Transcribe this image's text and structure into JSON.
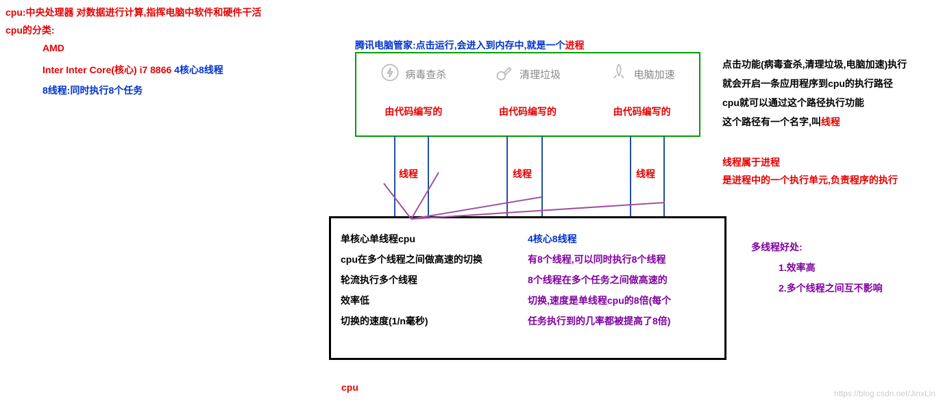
{
  "header": {
    "line1_red": "cpu:中央处理器 对数据进行计算,指挥电脑中软件和硬件干活",
    "line2_red": "cpu的分类:",
    "amd": "AMD",
    "inter_red": "Inter Inter Core(核心) i7 8866",
    "inter_blue": " 4核心8线程",
    "threads8": "8线程:同时执行8个任务"
  },
  "tencent": {
    "title_blue": "腾讯电脑管家:点击运行,会进入到内存中,就是一个",
    "title_red": "进程",
    "btn1": "病毒查杀",
    "btn2": "清理垃圾",
    "btn3": "电脑加速",
    "code1": "由代码编写的",
    "code2": "由代码编写的",
    "code3": "由代码编写的"
  },
  "right": {
    "l1": "点击功能(病毒查杀,清理垃圾,电脑加速)执行",
    "l2": "就会开启一条应用程序到cpu的执行路径",
    "l3_a": "cpu就可以通过这个路径执行功能",
    "l4_a": "这个路径有一个名字,叫",
    "l4_b": "线程",
    "r1": "线程属于进程",
    "r2": "是进程中的一个执行单元,负责程序的执行",
    "m_title": "多线程好处:",
    "m1": "1.效率高",
    "m2": "2.多个线程之间互不影响"
  },
  "threadlabels": {
    "t1": "线程",
    "t2": "线程",
    "t3": "线程"
  },
  "cpubox": {
    "left_title": "单核心单线程cpu",
    "left_l1": "cpu在多个线程之间做高速的切换",
    "left_l2": "轮流执行多个线程",
    "left_l3": "效率低",
    "left_l4": "切换的速度(1/n毫秒)",
    "right_title": "4核心8线程",
    "right_l1": "有8个线程,可以同时执行8个线程",
    "right_l2": "8个线程在多个任务之间做高速的",
    "right_l3": "切换,速度是单线程cpu的8倍(每个",
    "right_l4": "任务执行到的几率都被提高了8倍)"
  },
  "footer": {
    "cpu": "cpu",
    "watermark": "https://blog.csdn.net/JinxLin"
  }
}
